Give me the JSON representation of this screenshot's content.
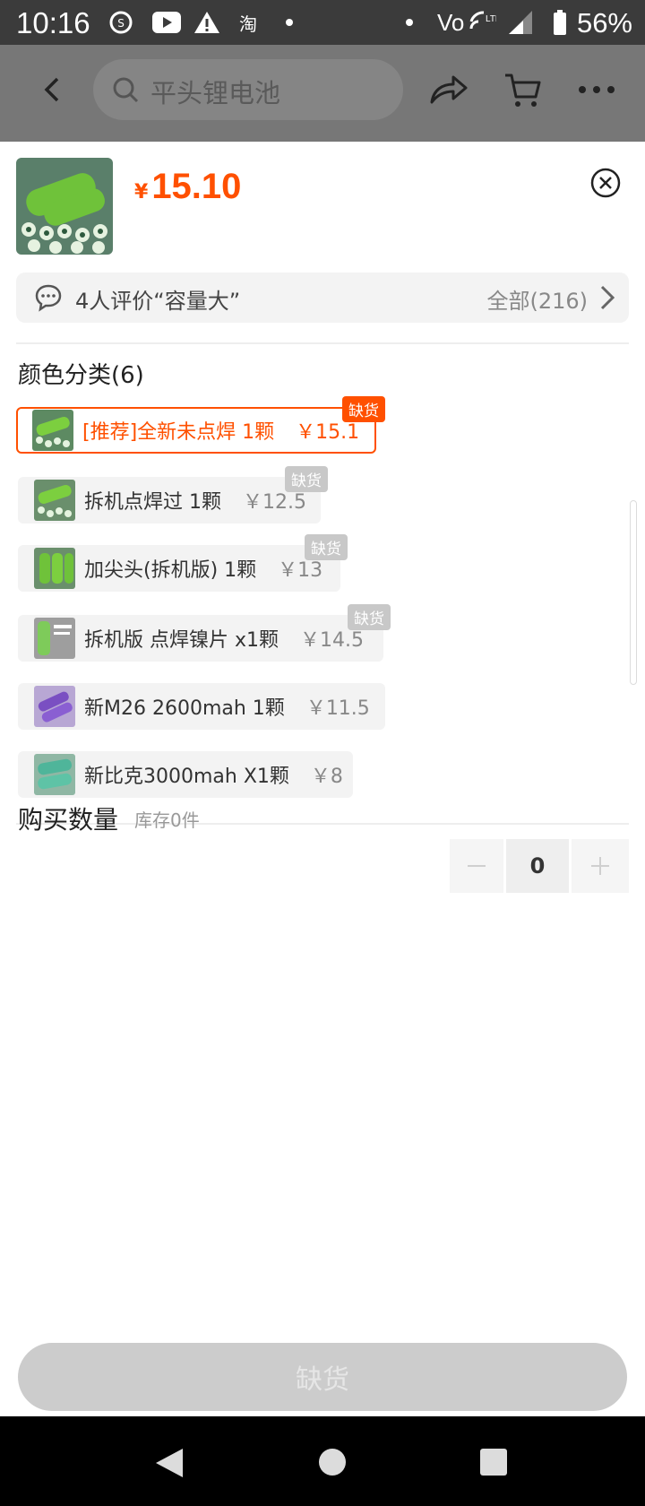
{
  "status_bar": {
    "time": "10:16",
    "battery": "56%",
    "taobao_glyph": "淘",
    "icons": [
      "s-circle-icon",
      "youtube-icon",
      "warning-icon",
      "taobao-icon",
      "dot-icon",
      "volte-wifi-icon",
      "signal-icon",
      "battery-icon"
    ]
  },
  "header": {
    "search_text": "平头锂电池"
  },
  "product": {
    "currency": "¥",
    "price": "15.10"
  },
  "review": {
    "text": "4人评价“容量大”",
    "all": "全部(216)"
  },
  "variants": {
    "title": "颜色分类(6)",
    "items": [
      {
        "label": "[推荐]全新未点焊 1颗",
        "price": "￥15.1",
        "badge": "缺货",
        "selected": true
      },
      {
        "label": "拆机点焊过 1颗",
        "price": "￥12.5",
        "badge": "缺货"
      },
      {
        "label": "加尖头(拆机版) 1颗",
        "price": "￥13",
        "badge": "缺货"
      },
      {
        "label": "拆机版  点焊镍片 x1颗",
        "price": "￥14.5",
        "badge": "缺货"
      },
      {
        "label": "新M26 2600mah   1颗",
        "price": "￥11.5"
      },
      {
        "label": "新比克3000mah X1颗",
        "price": "￥8"
      }
    ]
  },
  "quantity": {
    "label": "购买数量",
    "stock": "库存0件",
    "value": "0"
  },
  "buy_button": "缺货",
  "colors": {
    "accent": "#ff5000",
    "disabled": "#cccccc"
  }
}
